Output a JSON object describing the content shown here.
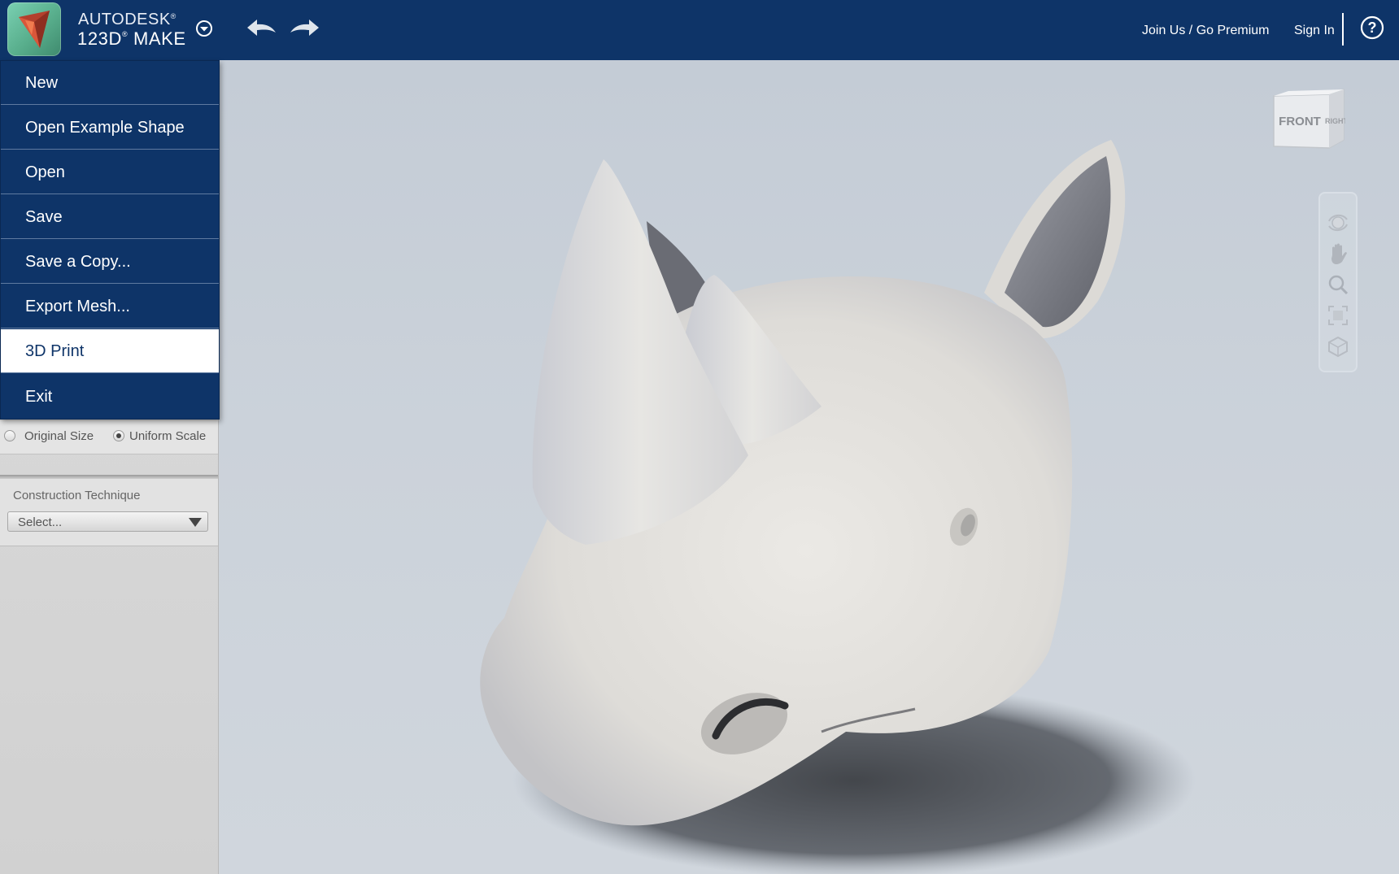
{
  "header": {
    "brand_company": "AUTODESK",
    "brand_product": "123D",
    "brand_product_suffix": "MAKE",
    "trademark": "®",
    "join_link": "Join Us / Go Premium",
    "signin_link": "Sign In",
    "help_label": "?"
  },
  "file_menu": {
    "items": [
      {
        "label": "New",
        "active": false
      },
      {
        "label": "Open Example Shape",
        "active": false
      },
      {
        "label": "Open",
        "active": false
      },
      {
        "label": "Save",
        "active": false
      },
      {
        "label": "Save a Copy...",
        "active": false
      },
      {
        "label": "Export Mesh...",
        "active": false
      },
      {
        "label": "3D Print",
        "active": true
      },
      {
        "label": "Exit",
        "active": false
      }
    ]
  },
  "size_options": {
    "original_size": "Original Size",
    "uniform_scale": "Uniform Scale",
    "selected": "Uniform Scale"
  },
  "construction": {
    "label": "Construction Technique",
    "select_value": "Select..."
  },
  "viewcube": {
    "front_label": "FRONT",
    "right_label": "RIGHT"
  },
  "nav_tools": [
    "orbit-icon",
    "pan-hand-icon",
    "zoom-icon",
    "fit-view-icon",
    "view-cube-home-icon"
  ],
  "colors": {
    "header_bg": "#0e3468",
    "menu_active_bg": "#ffffff",
    "viewport_bg": "#c9d1da",
    "model_color": "#e6e4e0"
  }
}
